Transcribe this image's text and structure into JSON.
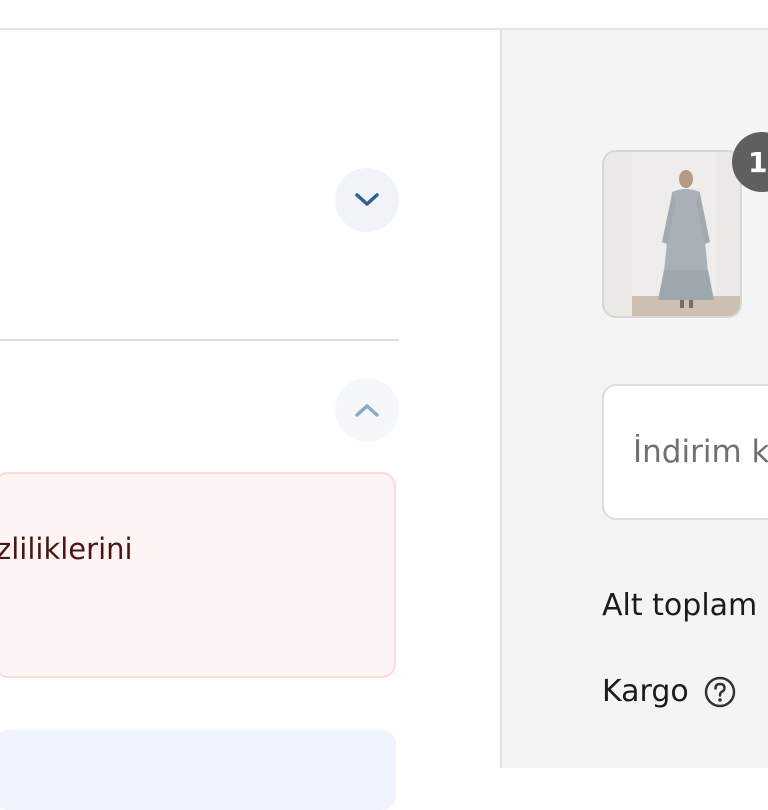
{
  "checkout": {
    "delivery_notice_text": "zliliklerini",
    "discount_placeholder": "İndirim k",
    "subtotal_label": "Alt toplam",
    "shipping_label": "Kargo",
    "cart_item_count": "1"
  },
  "icons": {
    "section_expand": "chevron-down-icon",
    "section_collapse": "chevron-up-icon",
    "shipping_help": "question-circle-icon"
  },
  "colors": {
    "accent_blue": "#3a6ea5",
    "alert_background": "#fff4f4",
    "alert_border": "#f9dcdc",
    "info_background": "#eef3fd",
    "summary_background": "#f4f4f4",
    "badge": "#5f5f5f"
  }
}
